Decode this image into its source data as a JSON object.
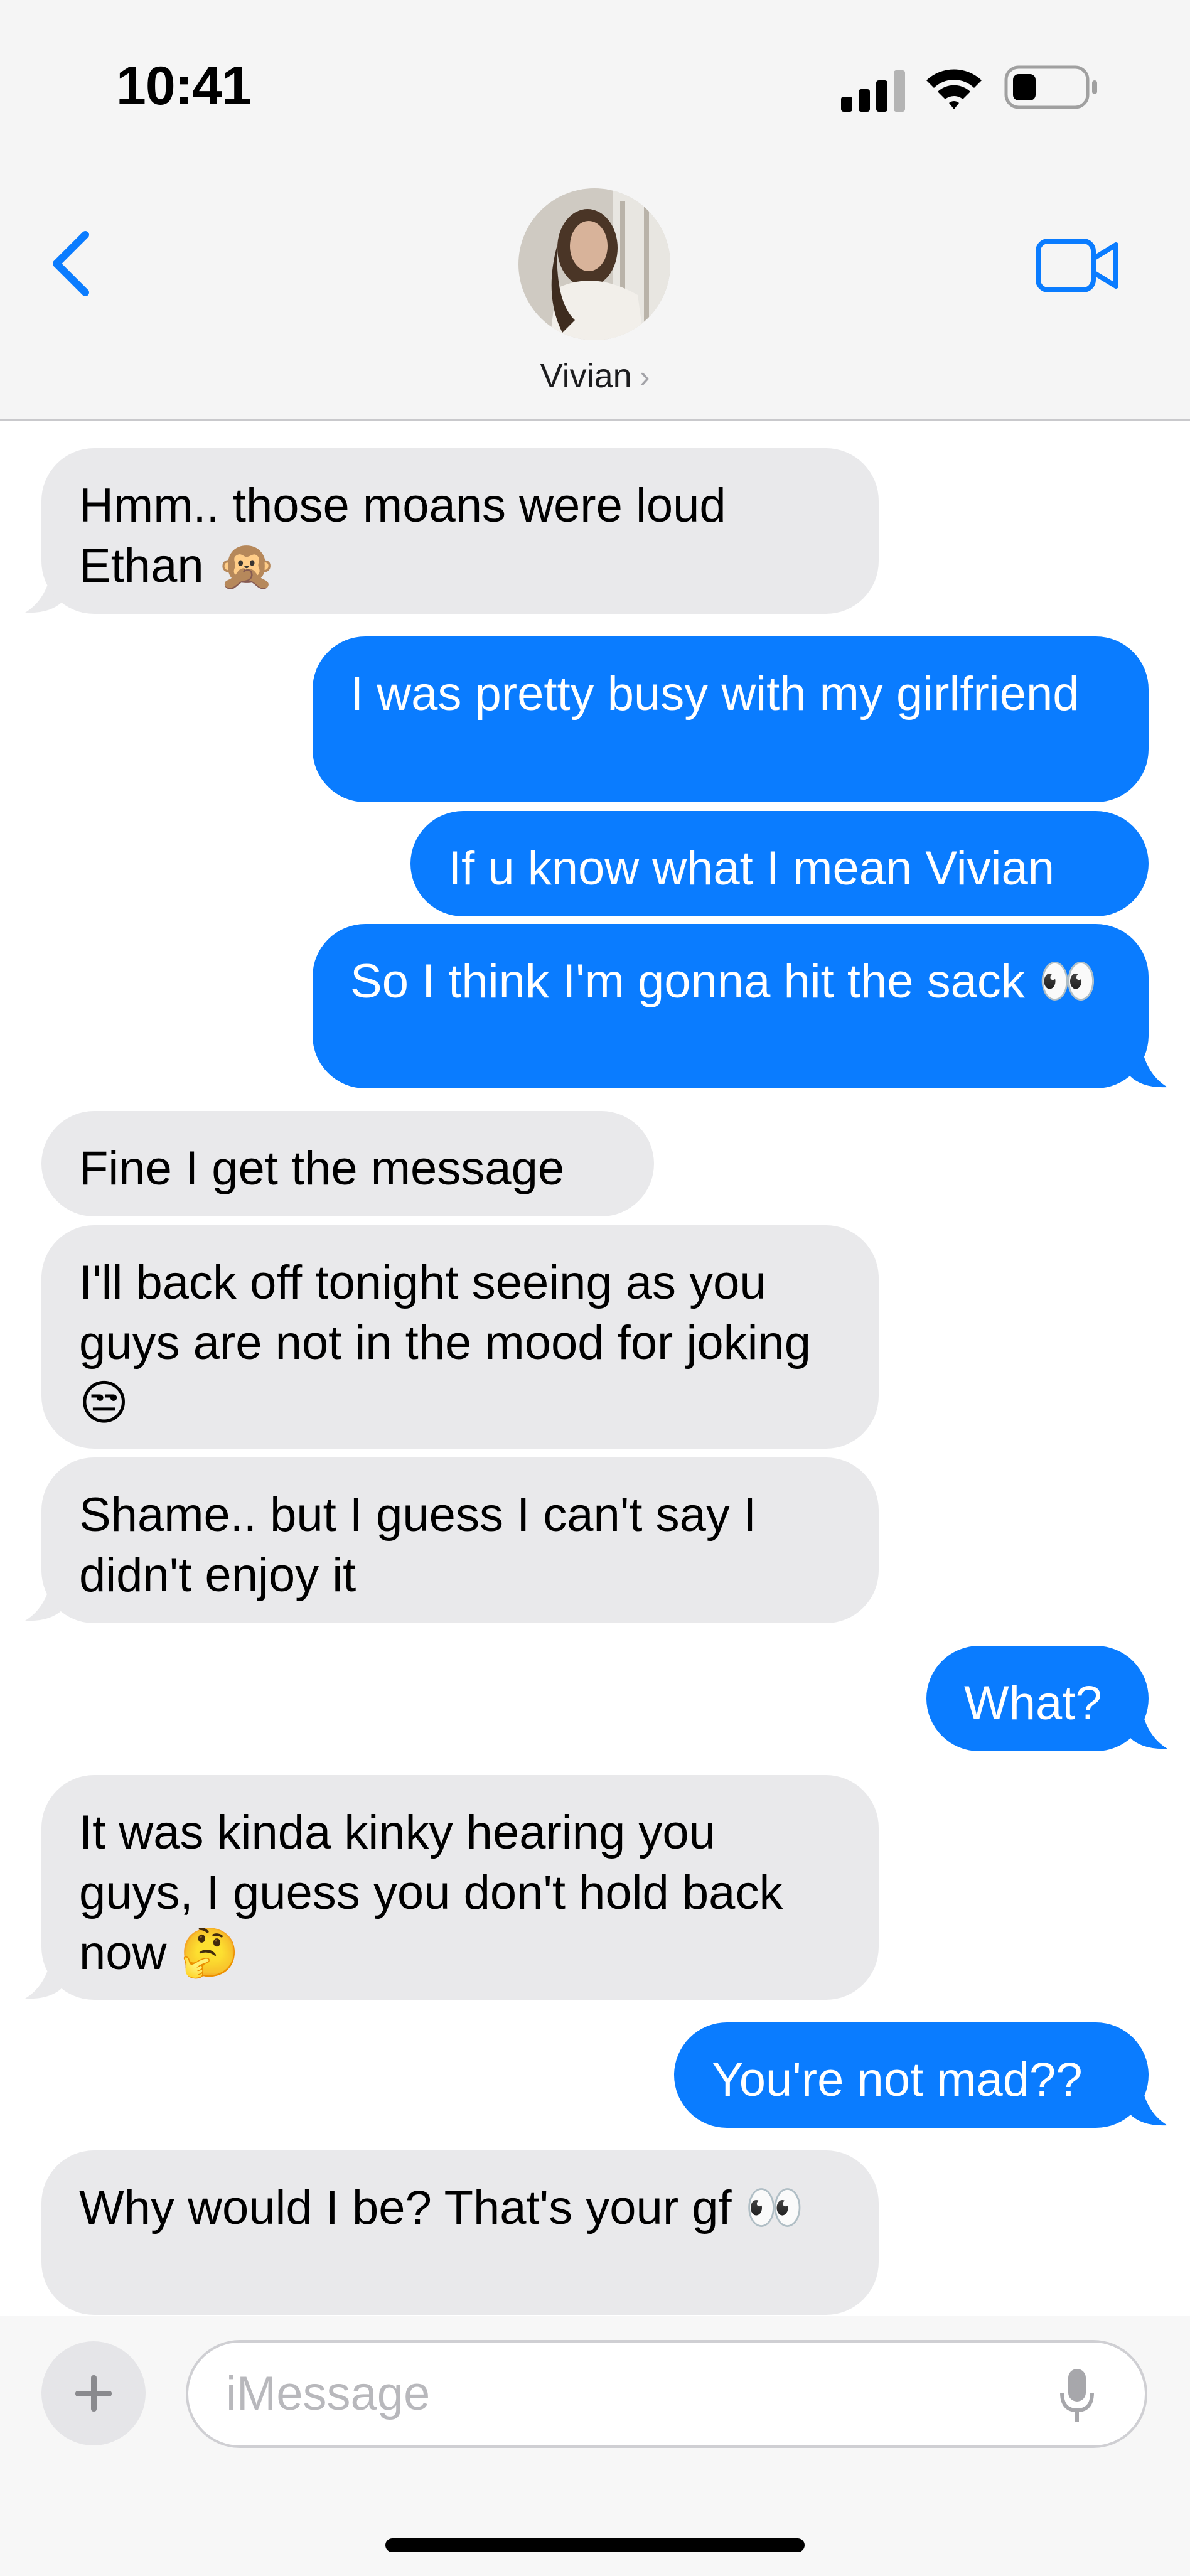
{
  "status_bar": {
    "time": "10:41"
  },
  "header": {
    "contact_name": "Vivian",
    "contact_chevron": "›"
  },
  "messages": [
    {
      "from": "them",
      "text": "Hmm.. those moans were loud Ethan 🙊"
    },
    {
      "from": "me",
      "text": "I was pretty busy with my girlfriend"
    },
    {
      "from": "me",
      "text": "If u know what I mean Vivian"
    },
    {
      "from": "me",
      "text": "So I think I'm gonna hit the sack 👀"
    },
    {
      "from": "them",
      "text": "Fine I get the message"
    },
    {
      "from": "them",
      "text": "I'll back off tonight seeing as you guys are not in the mood for joking 😒"
    },
    {
      "from": "them",
      "text": "Shame.. but I guess I can't say I didn't enjoy it"
    },
    {
      "from": "me",
      "text": "What?"
    },
    {
      "from": "them",
      "text": "It was kinda kinky hearing you guys, I guess you don't hold back now 🤔"
    },
    {
      "from": "me",
      "text": "You're not mad??"
    },
    {
      "from": "them",
      "text": "Why would I be? That's your gf 👀"
    }
  ],
  "composer": {
    "placeholder": "iMessage",
    "plus_label": "+"
  },
  "colors": {
    "outgoing": "#0a7cff",
    "incoming": "#e9e9eb",
    "accent": "#0a7cff"
  },
  "icons": [
    "back-chevron-icon",
    "video-call-icon",
    "signal-icon",
    "wifi-icon",
    "battery-icon",
    "mic-icon",
    "plus-icon"
  ]
}
